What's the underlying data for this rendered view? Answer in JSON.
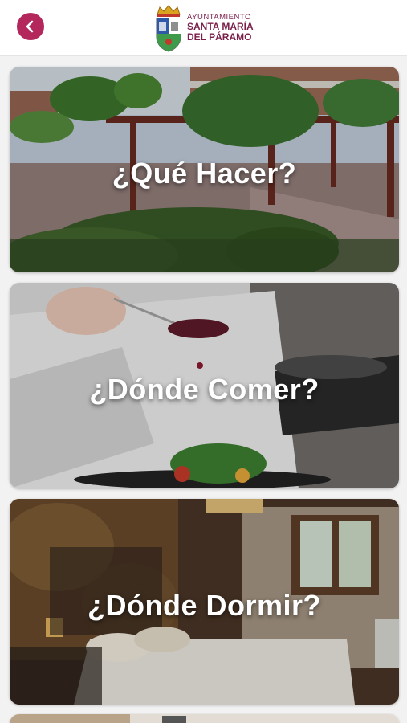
{
  "header": {
    "back_icon": "chevron-left-icon",
    "logo": {
      "line1": "AYUNTAMIENTO",
      "line2": "SANTA MARÍA",
      "line3": "DEL PÁRAMO"
    }
  },
  "cards": [
    {
      "title": "¿Qué Hacer?"
    },
    {
      "title": "¿Dónde Comer?"
    },
    {
      "title": "¿Dónde Dormir?"
    }
  ],
  "colors": {
    "accent": "#b3275c",
    "logo_text": "#7a1f4a"
  }
}
